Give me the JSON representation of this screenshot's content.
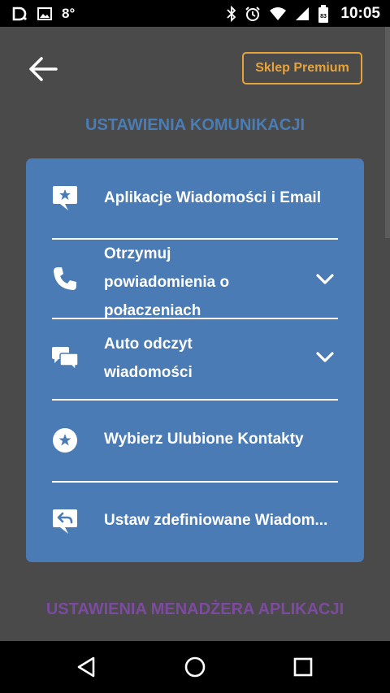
{
  "status_bar": {
    "battery_temp": "8°",
    "time": "10:05",
    "sim_badge": "83"
  },
  "header": {
    "premium_button_label": "Sklep Premium"
  },
  "sections": {
    "communication_title": "USTAWIENIA KOMUNIKACJI",
    "app_manager_title": "USTAWIENIA MENADŻERA APLIKACJI"
  },
  "settings": {
    "items": [
      {
        "label": "Aplikacje Wiadomości i Email",
        "icon": "message-star-icon"
      },
      {
        "label": "Otrzymuj powiadomienia o połaczeniach",
        "icon": "phone-icon",
        "expandable": true
      },
      {
        "label": "Auto odczyt wiadomości",
        "icon": "chat-bubbles-icon",
        "expandable": true
      },
      {
        "label": "Wybierz Ulubione Kontakty",
        "icon": "star-circle-icon"
      },
      {
        "label": "Ustaw zdefiniowane Wiadom...",
        "icon": "message-reply-icon"
      }
    ]
  },
  "colors": {
    "background": "#4a4a4a",
    "card": "#4b7bb4",
    "accent_orange": "#e6a33b",
    "section_blue": "#4a7cb5",
    "section_purple": "#7c4a9e"
  }
}
